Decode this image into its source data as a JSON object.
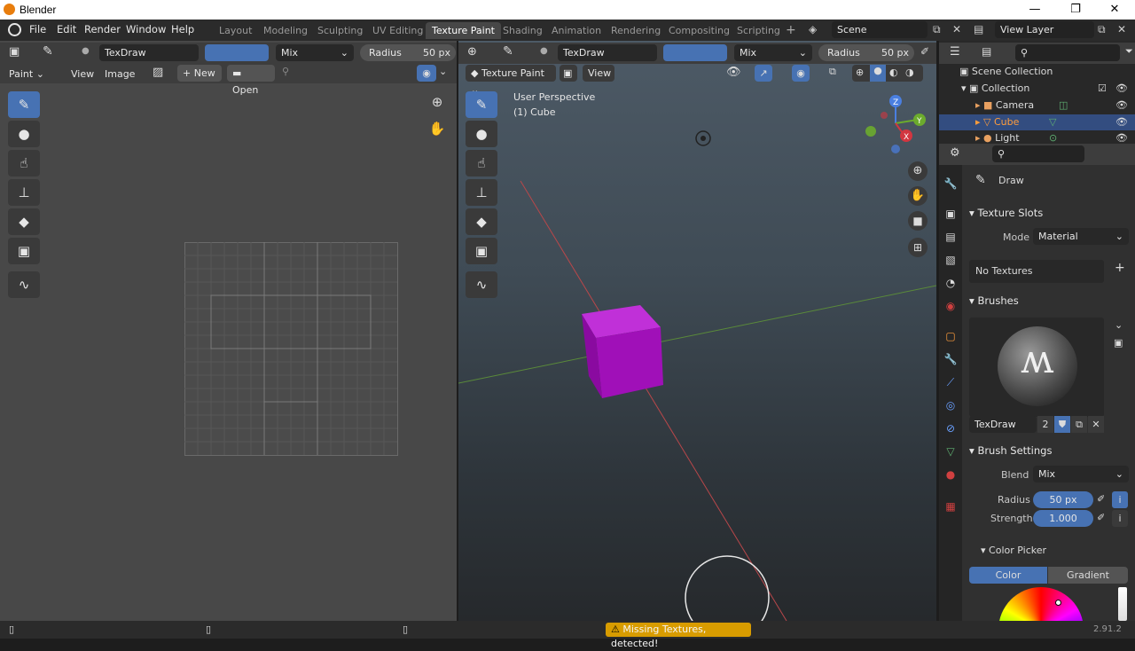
{
  "window": {
    "title": "Blender",
    "min": "—",
    "max": "❐",
    "close": "✕"
  },
  "menu": {
    "file": "File",
    "edit": "Edit",
    "render": "Render",
    "window": "Window",
    "help": "Help"
  },
  "workspaces": [
    "Layout",
    "Modeling",
    "Sculpting",
    "UV Editing",
    "Texture Paint",
    "Shading",
    "Animation",
    "Rendering",
    "Compositing",
    "Scripting"
  ],
  "active_workspace": "Texture Paint",
  "scene": {
    "name": "Scene",
    "view_layer": "View Layer"
  },
  "image_editor": {
    "brush_name": "TexDraw",
    "blend": "Mix",
    "radius_label": "Radius",
    "radius_value": "50 px",
    "mode": "Paint",
    "view": "View",
    "image": "Image",
    "new": "New",
    "open": "Open"
  },
  "viewport": {
    "brush_name": "TexDraw",
    "blend": "Mix",
    "radius_label": "Radius",
    "radius_value": "50 px",
    "mode": "Texture Paint",
    "view": "View",
    "perspective": "User Perspective",
    "object": "(1) Cube",
    "cube_color": "#a010b8",
    "axis_x": "X",
    "axis_y": "Y",
    "axis_z": "Z"
  },
  "outliner": {
    "scene_collection": "Scene Collection",
    "collection": "Collection",
    "items": [
      "Camera",
      "Cube",
      "Light"
    ],
    "selected": "Cube"
  },
  "properties": {
    "tool": "Draw",
    "texture_slots": "Texture Slots",
    "mode_label": "Mode",
    "mode_value": "Material",
    "no_textures": "No Textures",
    "brushes": "Brushes",
    "brush_name": "TexDraw",
    "brush_users": "2",
    "brush_settings": "Brush Settings",
    "blend_label": "Blend",
    "blend_value": "Mix",
    "radius_label": "Radius",
    "radius_value": "50 px",
    "strength_label": "Strength",
    "strength_value": "1.000",
    "color_picker": "Color Picker",
    "color_tab": "Color",
    "gradient_tab": "Gradient"
  },
  "status": {
    "warning": "Missing Textures, detected!",
    "version": "2.91.2"
  },
  "colors": {
    "accent": "#4772b3",
    "active_tab": "#474747",
    "warning": "#e8a200"
  }
}
